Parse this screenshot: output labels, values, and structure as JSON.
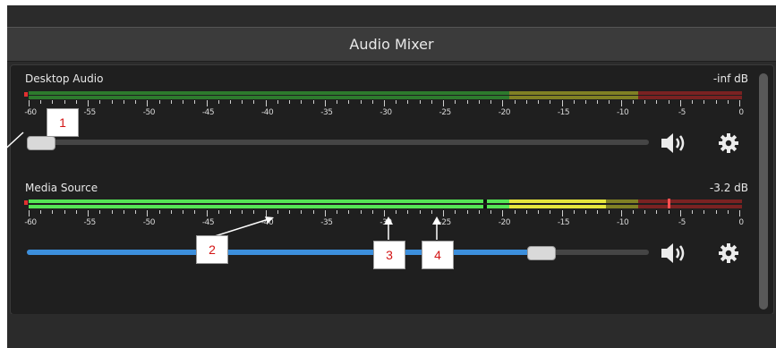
{
  "window": {
    "title": "Audio Mixer"
  },
  "channels": [
    {
      "name": "Desktop Audio",
      "level": "-inf dB",
      "volume": 0.0
    },
    {
      "name": "Media Source",
      "level": "-3.2 dB",
      "volume": 0.72
    }
  ],
  "scale_labels": [
    "-60",
    "-55",
    "-50",
    "-45",
    "-40",
    "-35",
    "-30",
    "-25",
    "-20",
    "-15",
    "-10",
    "-5",
    "0"
  ],
  "callouts": [
    {
      "label": "1"
    },
    {
      "label": "2"
    },
    {
      "label": "3"
    },
    {
      "label": "4"
    }
  ],
  "icons": {
    "mute": "speaker-icon",
    "settings": "gear-icon"
  },
  "colors": {
    "green": "#44c544",
    "yellow": "#d8d83a",
    "red": "#c93c3c",
    "accent": "#3c8fdc"
  }
}
